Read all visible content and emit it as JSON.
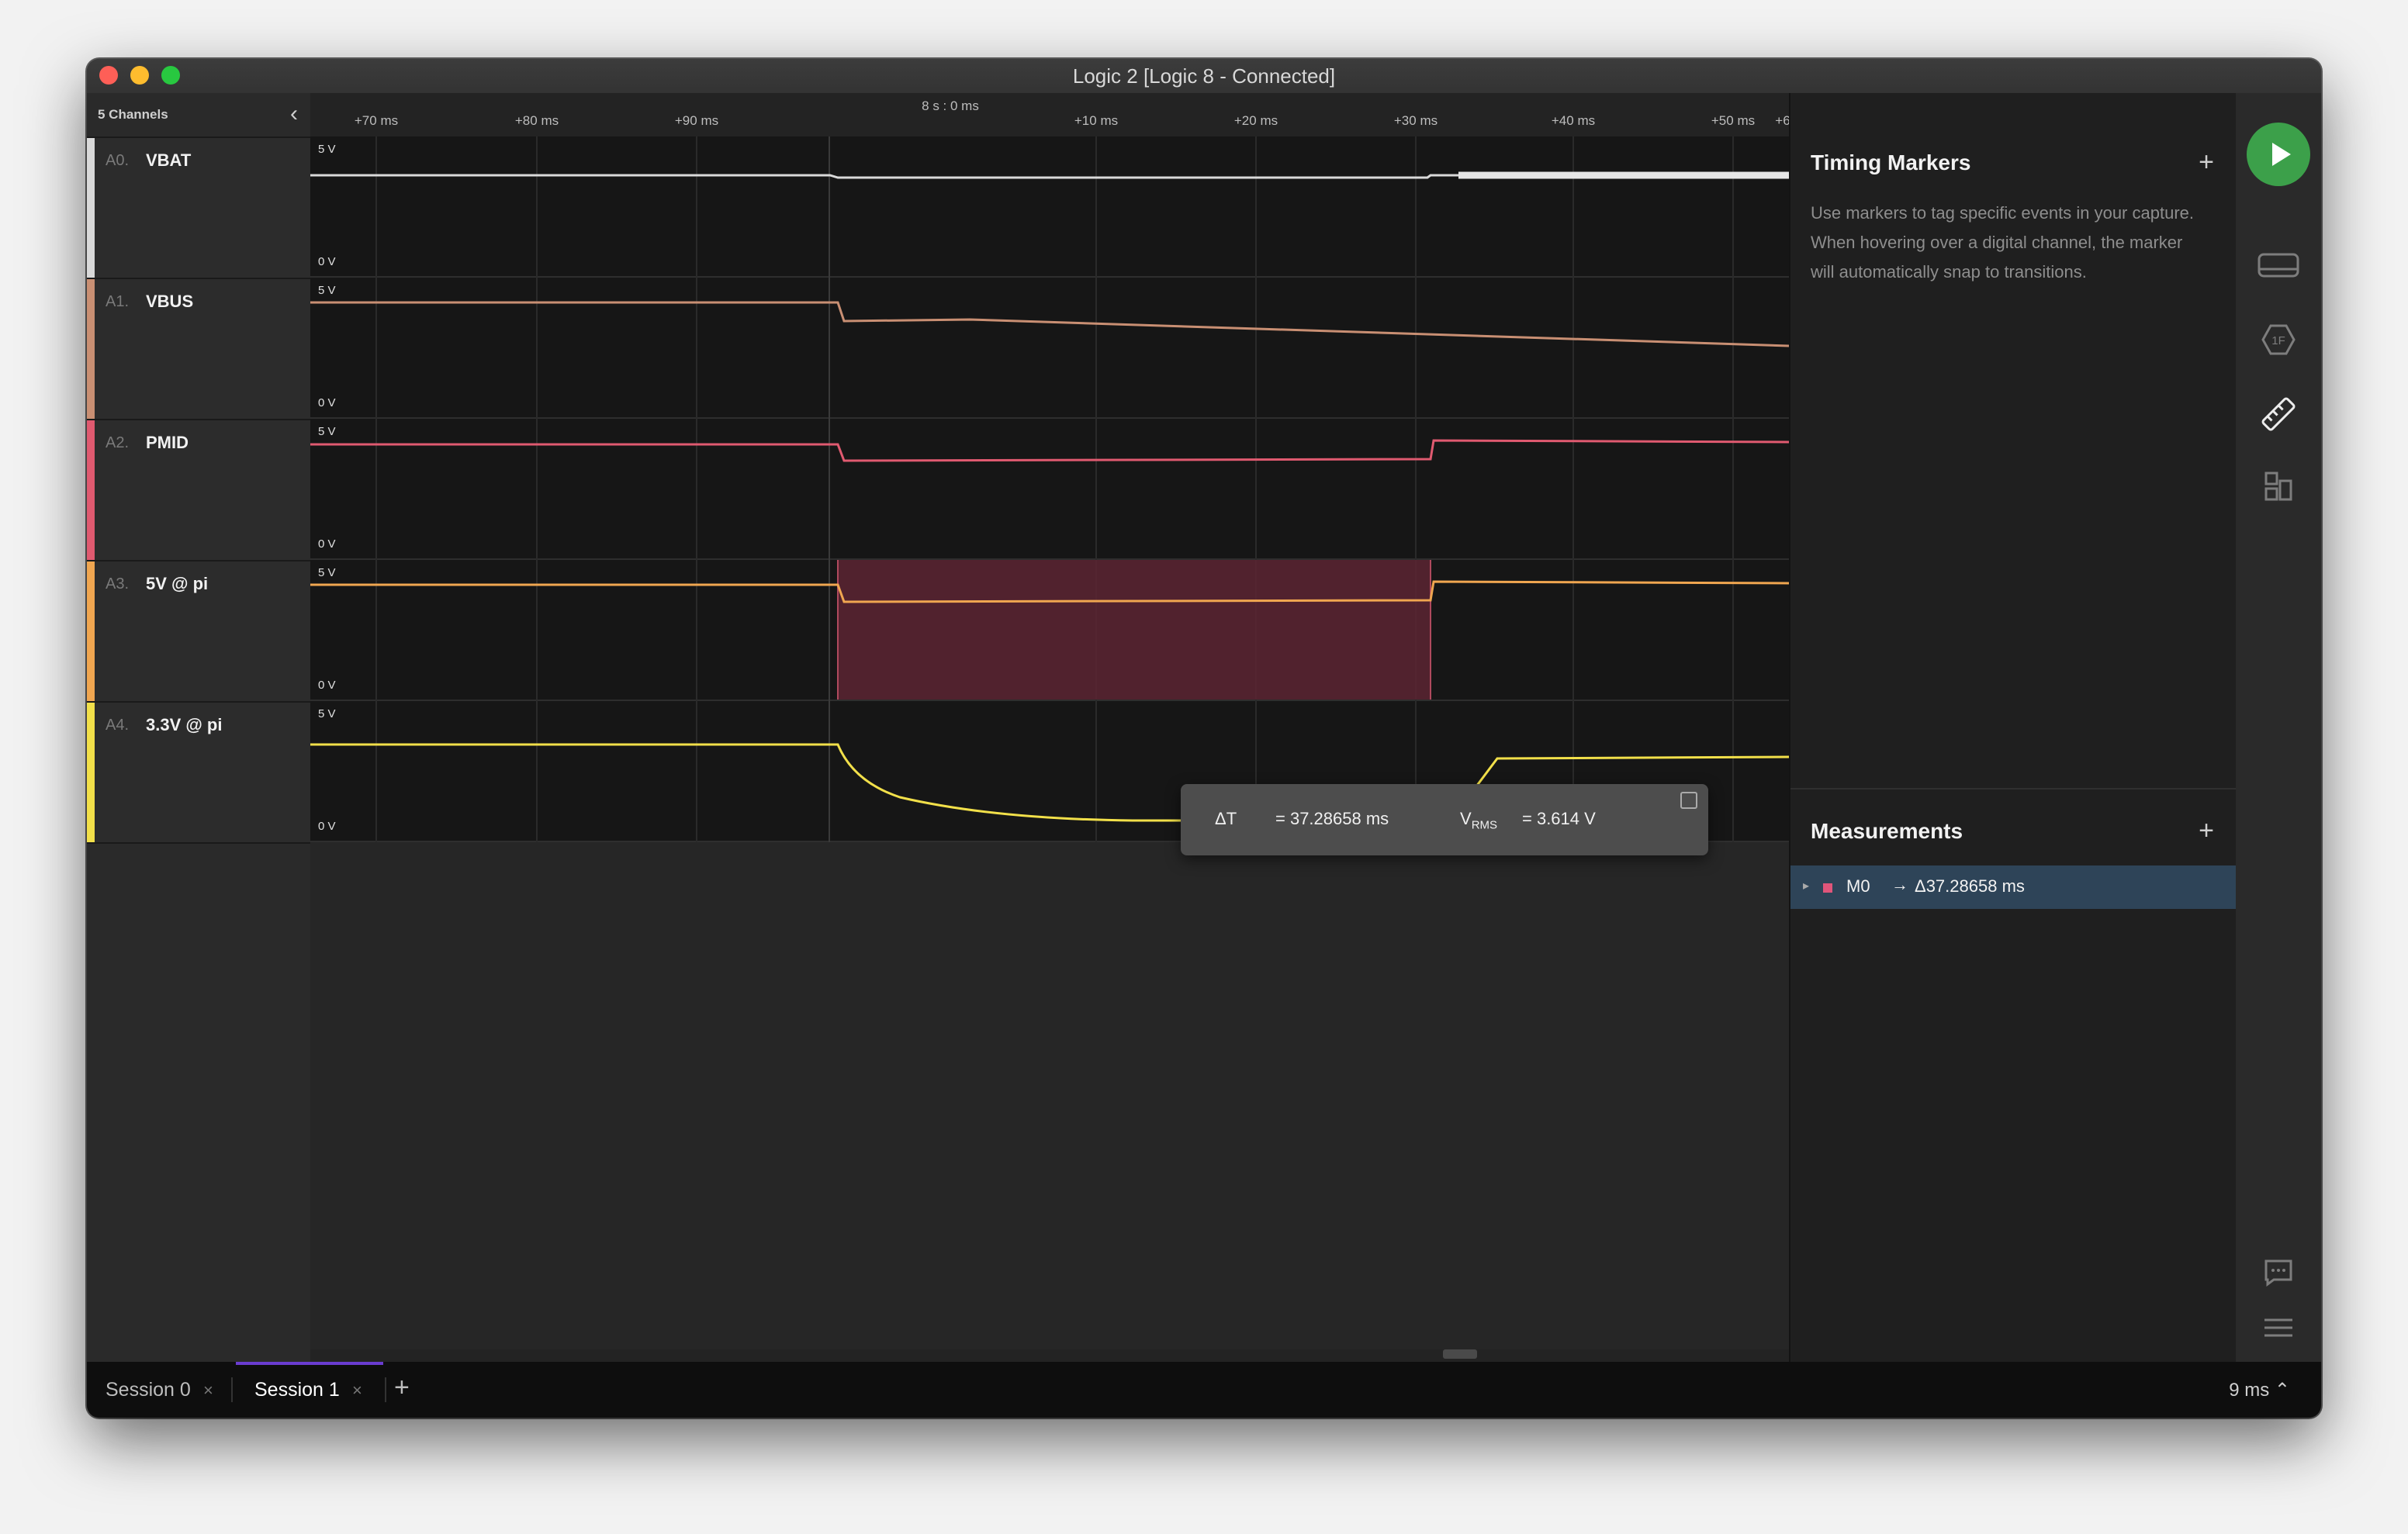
{
  "window": {
    "title": "Logic 2 [Logic 8 - Connected]"
  },
  "channels_panel": {
    "count_label": "5 Channels",
    "channels": [
      {
        "id": "A0.",
        "name": "VBAT",
        "color": "#d9d9d9"
      },
      {
        "id": "A1.",
        "name": "VBUS",
        "color": "#c98f73"
      },
      {
        "id": "A2.",
        "name": "PMID",
        "color": "#e05a70"
      },
      {
        "id": "A3.",
        "name": "5V @ pi",
        "color": "#f0a650"
      },
      {
        "id": "A4.",
        "name": "3.3V @ pi",
        "color": "#f2e04a"
      }
    ]
  },
  "ruler": {
    "origin_label": "8 s : 0 ms",
    "ticks": [
      "+70 ms",
      "+80 ms",
      "+90 ms",
      "+10 ms",
      "+20 ms",
      "+30 ms",
      "+40 ms",
      "+50 ms",
      "+6"
    ]
  },
  "lanes": {
    "top_label": "5 V",
    "bottom_label": "0 V"
  },
  "measurement_tooltip": {
    "dt_label": "ΔT",
    "dt_value": "= 37.28658 ms",
    "v_label_main": "V",
    "v_label_sub": "RMS",
    "v_value": "= 3.614 V"
  },
  "timing_markers": {
    "title": "Timing Markers",
    "add_label": "+",
    "help_text": "Use markers to tag specific events in your capture. When hovering over a digital channel, the marker will automatically snap to transitions."
  },
  "measurements": {
    "title": "Measurements",
    "add_label": "+",
    "items": [
      {
        "name": "M0",
        "arrow": "→",
        "value": "Δ37.28658 ms",
        "color": "#e0557a"
      }
    ]
  },
  "rail_icons": [
    "device-settings-icon",
    "analyzers-icon",
    "measure-icon",
    "extensions-icon",
    "feedback-icon",
    "menu-icon"
  ],
  "tabs": [
    {
      "label": "Session 0",
      "close": "×",
      "active": false
    },
    {
      "label": "Session 1",
      "close": "×",
      "active": true
    }
  ],
  "tab_add_label": "+",
  "zoom_readout": "9 ms ⌃"
}
